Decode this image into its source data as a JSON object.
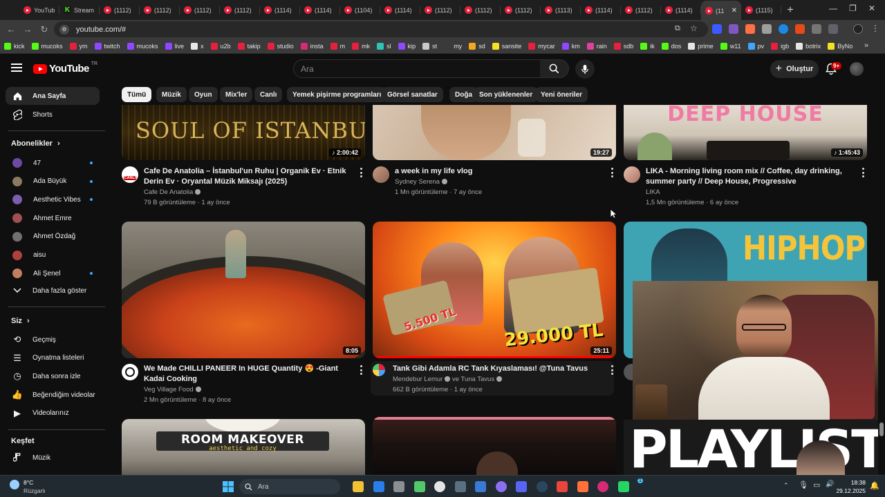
{
  "browser": {
    "tabs": [
      {
        "label": "YouTub",
        "icon": "youtube"
      },
      {
        "label": "Stream",
        "icon": "kick"
      },
      {
        "label": "(1112)",
        "icon": "youtube"
      },
      {
        "label": "(1112)",
        "icon": "youtube"
      },
      {
        "label": "(1112)",
        "icon": "youtube"
      },
      {
        "label": "(1112)",
        "icon": "youtube"
      },
      {
        "label": "(1114)",
        "icon": "youtube"
      },
      {
        "label": "(1114)",
        "icon": "youtube"
      },
      {
        "label": "(1104)",
        "icon": "youtube"
      },
      {
        "label": "(1114)",
        "icon": "youtube"
      },
      {
        "label": "(1112)",
        "icon": "youtube"
      },
      {
        "label": "(1112)",
        "icon": "youtube"
      },
      {
        "label": "(1112)",
        "icon": "youtube"
      },
      {
        "label": "(1113)",
        "icon": "youtube"
      },
      {
        "label": "(1114)",
        "icon": "youtube"
      },
      {
        "label": "(1112)",
        "icon": "youtube"
      },
      {
        "label": "(1114)",
        "icon": "youtube"
      },
      {
        "label": "(11",
        "icon": "youtube",
        "active": true
      },
      {
        "label": "(1115)",
        "icon": "youtube"
      }
    ],
    "url": "youtube.com/#",
    "bookmarks": [
      {
        "label": "kick",
        "color": "#53fc18"
      },
      {
        "label": "mucoks",
        "color": "#53fc18"
      },
      {
        "label": "ym",
        "color": "#e7203d"
      },
      {
        "label": "twitch",
        "color": "#9146ff"
      },
      {
        "label": "mucoks",
        "color": "#9146ff"
      },
      {
        "label": "live",
        "color": "#9146ff"
      },
      {
        "label": "x",
        "color": "#e6e6e6"
      },
      {
        "label": "u2b",
        "color": "#e7203d"
      },
      {
        "label": "takip",
        "color": "#e7203d"
      },
      {
        "label": "studio",
        "color": "#e7203d"
      },
      {
        "label": "insta",
        "color": "#d62976"
      },
      {
        "label": "m",
        "color": "#e7203d"
      },
      {
        "label": "mk",
        "color": "#e7203d"
      },
      {
        "label": "sl",
        "color": "#2ec4b6"
      },
      {
        "label": "kip",
        "color": "#9146ff"
      },
      {
        "label": "st",
        "color": "#c8c8c8"
      },
      {
        "label": "my",
        "color": "#3a3a3a"
      },
      {
        "label": "sd",
        "color": "#f5a623"
      },
      {
        "label": "sansite",
        "color": "#f5e023"
      },
      {
        "label": "mycar",
        "color": "#e7203d"
      },
      {
        "label": "km",
        "color": "#9146ff"
      },
      {
        "label": "rain",
        "color": "#e040a0"
      },
      {
        "label": "sdb",
        "color": "#e7203d"
      },
      {
        "label": "ik",
        "color": "#53fc18"
      },
      {
        "label": "dos",
        "color": "#53fc18"
      },
      {
        "label": "prime",
        "color": "#e6e6e6"
      },
      {
        "label": "w11",
        "color": "#53fc18"
      },
      {
        "label": "pv",
        "color": "#3ea6ff"
      },
      {
        "label": "igb",
        "color": "#e7203d"
      },
      {
        "label": "botrix",
        "color": "#e6e6e6"
      },
      {
        "label": "ByNo",
        "color": "#f5e023"
      }
    ]
  },
  "yt": {
    "logo": "YouTube",
    "logo_region": "TR",
    "search_placeholder": "Ara",
    "create_label": "Oluştur",
    "bell_badge": "9+",
    "nav": [
      {
        "label": "Ana Sayfa",
        "icon": "home-icon",
        "active": true
      },
      {
        "label": "Shorts",
        "icon": "shorts-icon"
      }
    ],
    "subs_title": "Abonelikler",
    "subs": [
      {
        "label": "47",
        "color": "#6b4aa0"
      },
      {
        "label": "Ada Büyük",
        "color": "#8a7a60"
      },
      {
        "label": "Aesthetic Vibes",
        "color": "#7a5fb0"
      },
      {
        "label": "Ahmet Emre",
        "color": "#a05050"
      },
      {
        "label": "Ahmet Özdağ",
        "color": "#707070"
      },
      {
        "label": "aisu",
        "color": "#b04040"
      },
      {
        "label": "Ali Şenel",
        "color": "#c08060"
      }
    ],
    "show_more": "Daha fazla göster",
    "you_title": "Siz",
    "you": [
      {
        "label": "Geçmiş",
        "icon": "history-icon"
      },
      {
        "label": "Oynatma listeleri",
        "icon": "playlists-icon"
      },
      {
        "label": "Daha sonra izle",
        "icon": "watch-later-icon"
      },
      {
        "label": "Beğendiğim videolar",
        "icon": "like-icon"
      },
      {
        "label": "Videolarınız",
        "icon": "your-videos-icon"
      }
    ],
    "explore_title": "Keşfet",
    "explore": [
      {
        "label": "Müzik",
        "icon": "music-icon"
      }
    ],
    "chips": [
      "Tümü",
      "Müzik",
      "Oyun",
      "Mix'ler",
      "Canlı",
      "Yemek pişirme programları",
      "Görsel sanatlar",
      "Doğa",
      "Son yüklenenler",
      "Yeni öneriler"
    ],
    "videos": [
      {
        "title": "Cafe De Anatolia – İstanbul'un Ruhu | Organik Ev · Etnik Derin Ev · Oryantal Müzik Miksajı (2025)",
        "channel": "Cafe De Anatolia",
        "stats": "79 B görüntüleme · 1 ay önce",
        "duration": "♪ 2:00:42",
        "thumb_text": "SOUL OF ISTANBUL"
      },
      {
        "title": "a week in my life vlog",
        "channel": "Sydney Serena",
        "stats": "1 Mn görüntüleme · 7 ay önce",
        "duration": "19:27",
        "thumb_text": ""
      },
      {
        "title": "LIKA - Morning living room mix // Coffee, day drinking, summer party // Deep House, Progressive",
        "channel": "LIKA",
        "stats": "1,5 Mn görüntüleme · 6 ay önce",
        "duration": "♪ 1:45:43",
        "thumb_text": "DEEP HOUSE"
      },
      {
        "title": "We Made CHILLI PANEER In HUGE Quantity 😍 -Giant Kadai Cooking",
        "channel": "Veg Village Food",
        "stats": "2 Mn görüntüleme · 8 ay önce",
        "duration": "8:05",
        "thumb_text": ""
      },
      {
        "title": "Tank Gibi Adamla RC Tank Kıyaslaması! @Tuna Tavus",
        "channel": "Mendebur Lemur",
        "channel2": "ve Tuna Tavus",
        "stats": "662 B görüntüleme · 1 ay önce",
        "duration": "25:11",
        "thumb_text": "5.500 TL",
        "thumb_text2": "29.000 TL"
      },
      {
        "title": "",
        "channel": "",
        "stats": "",
        "duration": "",
        "thumb_text": "HIPHOP JAZZ"
      },
      {
        "title": "",
        "channel": "",
        "stats": "",
        "duration": "",
        "thumb_text": "ROOM MAKEOVER",
        "thumb_sub": "aesthetic and cozy"
      },
      {
        "title": "",
        "channel": "",
        "stats": "",
        "duration": "",
        "thumb_text": ""
      },
      {
        "title": "",
        "channel": "",
        "stats": "",
        "duration": "",
        "thumb_text": "PLAYLIST"
      }
    ],
    "canli_badge": "CANLI"
  },
  "taskbar": {
    "temp": "8°C",
    "weather": "Rüzgarlı",
    "search_placeholder": "Ara",
    "time": "18:38",
    "date": "29.12.2025",
    "apps": [
      "windows-icon",
      "file-explorer-icon",
      "store-icon",
      "settings-icon",
      "headset-icon",
      "chatgpt-icon",
      "app-icon",
      "app-icon",
      "discord-icon",
      "steam-icon",
      "chrome-icon",
      "firefox-icon",
      "instagram-icon",
      "whatsapp-icon",
      "app-icon"
    ],
    "whatsapp_badge": "1"
  },
  "colors": {
    "accent": "#ff0000",
    "bg": "#0f0f0f",
    "chip": "#272727",
    "link_blue": "#3ea6ff"
  }
}
